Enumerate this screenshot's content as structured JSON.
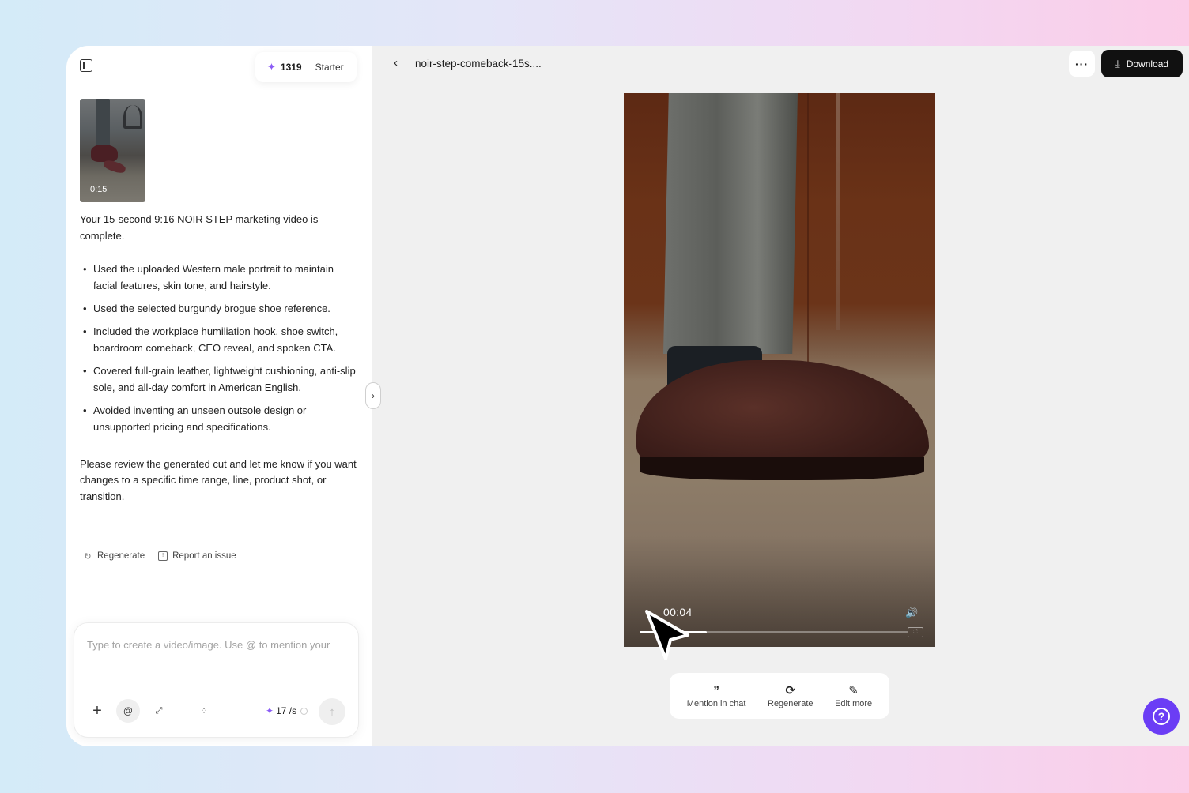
{
  "credits": {
    "amount": "1319",
    "plan": "Starter"
  },
  "thumbnail": {
    "duration": "0:15"
  },
  "message": {
    "intro": "Your 15-second 9:16 NOIR STEP marketing video is complete.",
    "bullets": [
      "Used the uploaded Western male portrait to maintain facial features, skin tone, and hairstyle.",
      "Used the selected burgundy brogue shoe reference.",
      "Included the workplace humiliation hook, shoe switch, boardroom comeback, CEO reveal, and spoken CTA.",
      "Covered full-grain leather, lightweight cushioning, anti-slip sole, and all-day comfort in American English.",
      "Avoided inventing an unseen outsole design or unsupported pricing and specifications."
    ],
    "outro": "Please review the generated cut and let me know if you want changes to a specific time range, line, product shot, or transition."
  },
  "message_actions": {
    "regenerate": "Regenerate",
    "report": "Report an issue"
  },
  "composer": {
    "placeholder": "Type to create a video/image. Use @ to mention your",
    "rate": "17 /s"
  },
  "header": {
    "file_title": "noir-step-comeback-15s....",
    "download": "Download"
  },
  "player": {
    "time": "00:04",
    "progress": 0.25
  },
  "video_toolbar": {
    "mention": "Mention in chat",
    "regenerate": "Regenerate",
    "edit": "Edit more"
  },
  "colors": {
    "accent": "#8b5cf6",
    "help_button": "#6b3df5",
    "download_bg": "#111111"
  }
}
